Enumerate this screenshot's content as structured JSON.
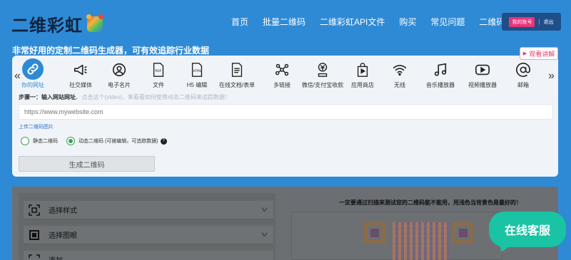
{
  "header": {
    "logo_text": "二维彩虹",
    "nav": [
      "首页",
      "批量二维码",
      "二维彩虹API文件",
      "购买",
      "常见问题",
      "二维码学院"
    ],
    "account_label": "我的账号",
    "separator": "|",
    "logout_label": "退出"
  },
  "tagline": "非常好用的定制二维码生成器，可有效追踪行业数据",
  "tutorial_label": "观看讲解",
  "tabs": [
    {
      "label": "你的网址",
      "icon": "link-icon",
      "active": true
    },
    {
      "label": "社交媒体",
      "icon": "megaphone-icon"
    },
    {
      "label": "电子名片",
      "icon": "user-icon"
    },
    {
      "label": "文件",
      "icon": "pdf-file-icon"
    },
    {
      "label": "H5 编辑",
      "icon": "html-file-icon"
    },
    {
      "label": "在线文档/表单",
      "icon": "document-icon"
    },
    {
      "label": "多链接",
      "icon": "network-icon"
    },
    {
      "label": "微信/支付宝收款",
      "icon": "payment-icon"
    },
    {
      "label": "应用商店",
      "icon": "app-store-icon"
    },
    {
      "label": "无线",
      "icon": "wifi-icon"
    },
    {
      "label": "音乐播放器",
      "icon": "music-icon"
    },
    {
      "label": "视频播放器",
      "icon": "video-icon"
    },
    {
      "label": "邮箱",
      "icon": "at-icon"
    }
  ],
  "step": {
    "title": "步骤一：输入网站网址.",
    "hint": "点击这个(video)，来看看如何使用动态二维码来追踪数据！"
  },
  "url_input": {
    "placeholder": "https://www.mywebsite.com",
    "value": ""
  },
  "upload_link": "上传二维码图片",
  "radio": {
    "static_label": "静态二维码",
    "dynamic_label": "动态二维码 (可被编辑，可追踪数据)",
    "selected": "dynamic"
  },
  "generate_label": "生成二维码",
  "lower": {
    "accordion": [
      "选择样式",
      "选择图眼",
      "添加"
    ],
    "test_notice": "一定要通过扫描来测试您的二维码能不能用，用浅色当背景色是最好的！"
  },
  "chat_label": "在线客服",
  "colors": {
    "primary": "#2f8ad6",
    "accent": "#e8357a",
    "chat": "#19c3a4"
  }
}
